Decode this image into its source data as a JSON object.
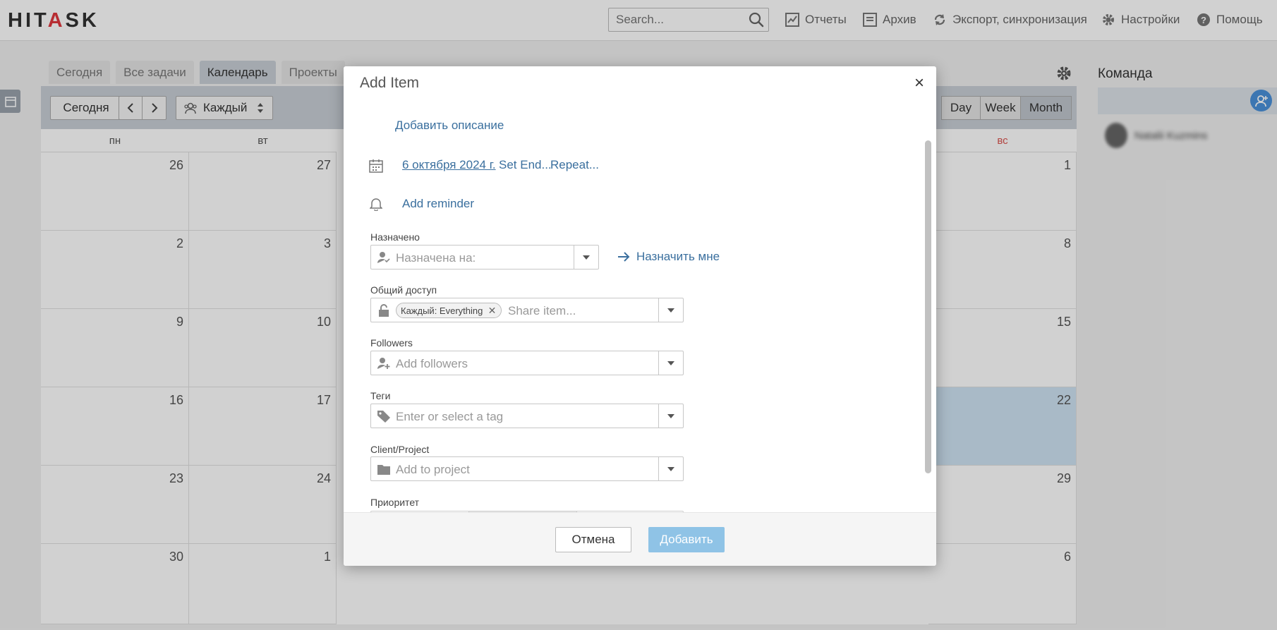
{
  "header": {
    "logo_prefix": "HIT",
    "logo_accent": "A",
    "logo_suffix": "SK",
    "search_placeholder": "Search...",
    "nav": {
      "reports": "Отчеты",
      "archive": "Архив",
      "export": "Экспорт, синхронизация",
      "settings": "Настройки",
      "help": "Помощь"
    }
  },
  "tabs": [
    "Сегодня",
    "Все задачи",
    "Календарь",
    "Проекты"
  ],
  "toolbar": {
    "today": "Сегодня",
    "filter": "Каждый",
    "views": {
      "day": "Day",
      "week": "Week",
      "month": "Month"
    }
  },
  "calendar": {
    "days": {
      "mon": "пн",
      "tue": "вт",
      "sun": "вс"
    },
    "rows": [
      {
        "mon": "26",
        "tue": "27",
        "sun": "1"
      },
      {
        "mon": "2",
        "tue": "3",
        "sun": "8"
      },
      {
        "mon": "9",
        "tue": "10",
        "sun": "15"
      },
      {
        "mon": "16",
        "tue": "17",
        "sun": "22"
      },
      {
        "mon": "23",
        "tue": "24",
        "sun": "29"
      },
      {
        "mon": "30",
        "tue": "1",
        "sun": "6"
      }
    ]
  },
  "team": {
    "title": "Команда",
    "member_name": "Natalii Kuzmins"
  },
  "modal": {
    "title": "Add Item",
    "close": "×",
    "add_description": "Добавить описание",
    "date": "6 октября 2024 г.",
    "set_end": "Set End...",
    "repeat": "Repeat...",
    "add_reminder": "Add reminder",
    "assigned": {
      "label": "Назначено",
      "placeholder": "Назначена на:",
      "assign_me": "Назначить мне"
    },
    "sharing": {
      "label": "Общий доступ",
      "chip": "Каждый: Everything",
      "placeholder": "Share item..."
    },
    "followers": {
      "label": "Followers",
      "placeholder": "Add followers"
    },
    "tags": {
      "label": "Теги",
      "placeholder": "Enter or select a tag"
    },
    "project": {
      "label": "Client/Project",
      "placeholder": "Add to project"
    },
    "priority": {
      "label": "Приоритет"
    },
    "cancel": "Отмена",
    "submit": "Добавить"
  }
}
